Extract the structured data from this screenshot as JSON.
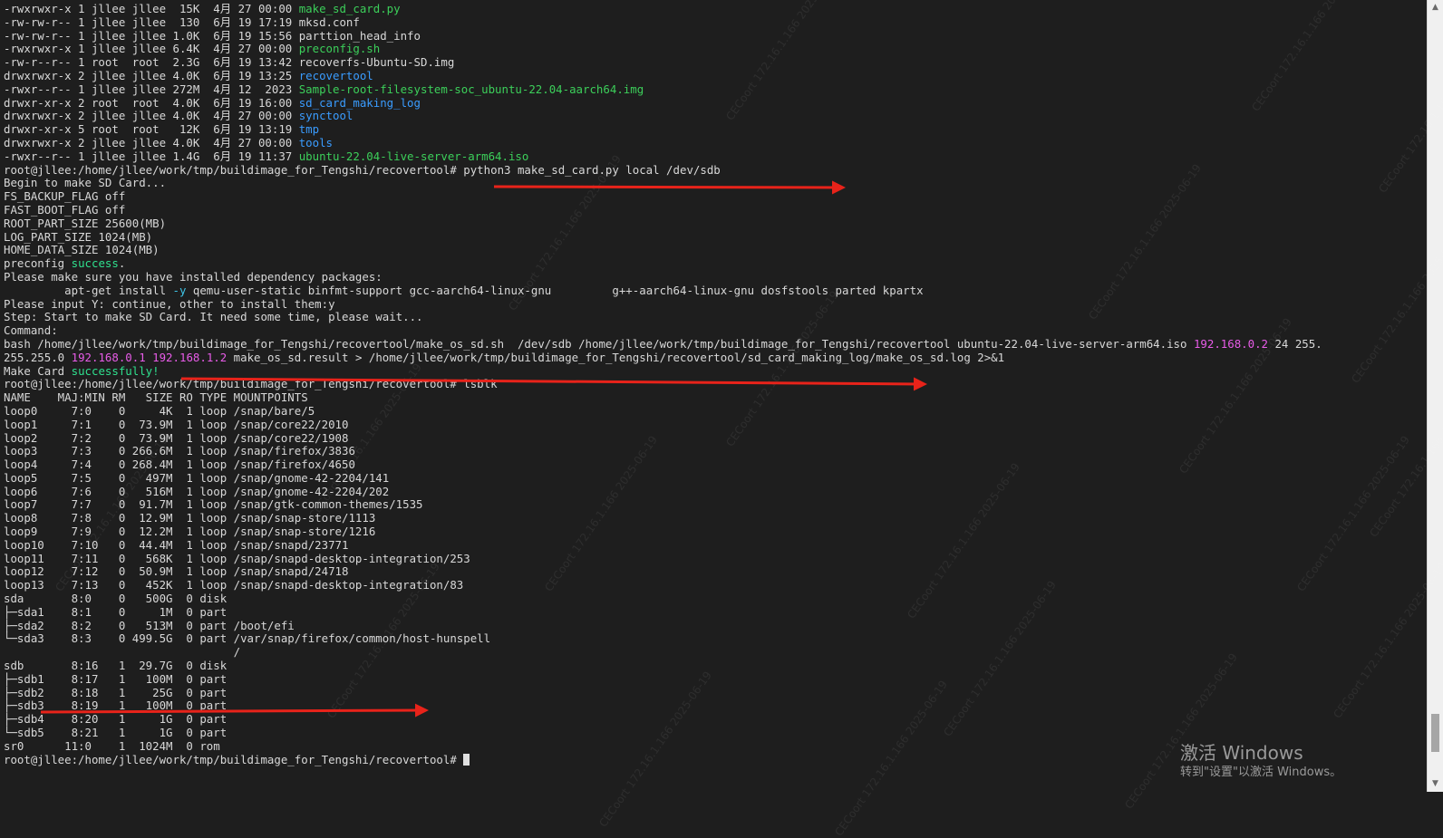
{
  "terminal": {
    "lines": [
      [
        {
          "t": "-rwxrwxr-x 1 jllee jllee  15K  4月 27 00:00 "
        },
        {
          "t": "make_sd_card.py",
          "c": "green"
        }
      ],
      [
        {
          "t": "-rw-rw-r-- 1 jllee jllee  130  6月 19 17:19 mksd.conf"
        }
      ],
      [
        {
          "t": "-rw-rw-r-- 1 jllee jllee 1.0K  6月 19 15:56 parttion_head_info"
        }
      ],
      [
        {
          "t": "-rwxrwxr-x 1 jllee jllee 6.4K  4月 27 00:00 "
        },
        {
          "t": "preconfig.sh",
          "c": "green"
        }
      ],
      [
        {
          "t": "-rw-r--r-- 1 root  root  2.3G  6月 19 13:42 recoverfs-Ubuntu-SD.img"
        }
      ],
      [
        {
          "t": "drwxrwxr-x 2 jllee jllee 4.0K  6月 19 13:25 "
        },
        {
          "t": "recovertool",
          "c": "blue"
        }
      ],
      [
        {
          "t": "-rwxr--r-- 1 jllee jllee 272M  4月 12  2023 "
        },
        {
          "t": "Sample-root-filesystem-soc_ubuntu-22.04-aarch64.img",
          "c": "green"
        }
      ],
      [
        {
          "t": "drwxr-xr-x 2 root  root  4.0K  6月 19 16:00 "
        },
        {
          "t": "sd_card_making_log",
          "c": "blue"
        }
      ],
      [
        {
          "t": "drwxrwxr-x 2 jllee jllee 4.0K  4月 27 00:00 "
        },
        {
          "t": "synctool",
          "c": "blue"
        }
      ],
      [
        {
          "t": "drwxr-xr-x 5 root  root   12K  6月 19 13:19 "
        },
        {
          "t": "tmp",
          "c": "blue"
        }
      ],
      [
        {
          "t": "drwxrwxr-x 2 jllee jllee 4.0K  4月 27 00:00 "
        },
        {
          "t": "tools",
          "c": "blue"
        }
      ],
      [
        {
          "t": "-rwxr--r-- 1 jllee jllee 1.4G  6月 19 11:37 "
        },
        {
          "t": "ubuntu-22.04-live-server-arm64.iso",
          "c": "green"
        }
      ],
      [
        {
          "t": "root@jllee:/home/jllee/work/tmp/buildimage_for_Tengshi/recovertool# python3 make_sd_card.py local /dev/sdb"
        }
      ],
      [
        {
          "t": "Begin to make SD Card..."
        }
      ],
      [
        {
          "t": "FS_BACKUP_FLAG off"
        }
      ],
      [
        {
          "t": "FAST_BOOT_FLAG off"
        }
      ],
      [
        {
          "t": "ROOT_PART_SIZE 25600(MB)"
        }
      ],
      [
        {
          "t": "LOG_PART_SIZE 1024(MB)"
        }
      ],
      [
        {
          "t": "HOME_DATA_SIZE 1024(MB)"
        }
      ],
      [
        {
          "t": "preconfig "
        },
        {
          "t": "success",
          "c": "bgreen"
        },
        {
          "t": "."
        }
      ],
      [
        {
          "t": "Please make sure you have installed dependency packages:"
        }
      ],
      [
        {
          "t": "         apt-get install "
        },
        {
          "t": "-y",
          "c": "cyan"
        },
        {
          "t": " qemu-user-static binfmt-support gcc-aarch64-linux-gnu         g++-aarch64-linux-gnu dosfstools parted kpartx"
        }
      ],
      [
        {
          "t": "Please input Y: continue, other to install them:y"
        }
      ],
      [
        {
          "t": "Step: Start to make SD Card. It need some time, please wait..."
        }
      ],
      [
        {
          "t": "Command:"
        }
      ],
      [
        {
          "t": "bash /home/jllee/work/tmp/buildimage_for_Tengshi/recovertool/make_os_sd.sh  /dev/sdb /home/jllee/work/tmp/buildimage_for_Tengshi/recovertool ubuntu-22.04-live-server-arm64.iso "
        },
        {
          "t": "192.168.0.2",
          "c": "magenta"
        },
        {
          "t": " 24 255."
        }
      ],
      [
        {
          "t": "255.255.0 "
        },
        {
          "t": "192.168.0.1",
          "c": "magenta"
        },
        {
          "t": " "
        },
        {
          "t": "192.168.1.2",
          "c": "magenta"
        },
        {
          "t": " make_os_sd.result > /home/jllee/work/tmp/buildimage_for_Tengshi/recovertool/sd_card_making_log/make_os_sd.log 2>&1"
        }
      ],
      [
        {
          "t": "Make Card "
        },
        {
          "t": "successfully!",
          "c": "bgreen"
        }
      ],
      [
        {
          "t": "root@jllee:/home/jllee/work/tmp/buildimage_for_Tengshi/recovertool# lsblk"
        }
      ],
      [
        {
          "t": "NAME    MAJ:MIN RM   SIZE RO TYPE MOUNTPOINTS"
        }
      ],
      [
        {
          "t": "loop0     7:0    0     4K  1 loop /snap/bare/5"
        }
      ],
      [
        {
          "t": "loop1     7:1    0  73.9M  1 loop /snap/core22/2010"
        }
      ],
      [
        {
          "t": "loop2     7:2    0  73.9M  1 loop /snap/core22/1908"
        }
      ],
      [
        {
          "t": "loop3     7:3    0 266.6M  1 loop /snap/firefox/3836"
        }
      ],
      [
        {
          "t": "loop4     7:4    0 268.4M  1 loop /snap/firefox/4650"
        }
      ],
      [
        {
          "t": "loop5     7:5    0   497M  1 loop /snap/gnome-42-2204/141"
        }
      ],
      [
        {
          "t": "loop6     7:6    0   516M  1 loop /snap/gnome-42-2204/202"
        }
      ],
      [
        {
          "t": "loop7     7:7    0  91.7M  1 loop /snap/gtk-common-themes/1535"
        }
      ],
      [
        {
          "t": "loop8     7:8    0  12.9M  1 loop /snap/snap-store/1113"
        }
      ],
      [
        {
          "t": "loop9     7:9    0  12.2M  1 loop /snap/snap-store/1216"
        }
      ],
      [
        {
          "t": "loop10    7:10   0  44.4M  1 loop /snap/snapd/23771"
        }
      ],
      [
        {
          "t": "loop11    7:11   0   568K  1 loop /snap/snapd-desktop-integration/253"
        }
      ],
      [
        {
          "t": "loop12    7:12   0  50.9M  1 loop /snap/snapd/24718"
        }
      ],
      [
        {
          "t": "loop13    7:13   0   452K  1 loop /snap/snapd-desktop-integration/83"
        }
      ],
      [
        {
          "t": "sda       8:0    0   500G  0 disk"
        }
      ],
      [
        {
          "t": "├─sda1    8:1    0     1M  0 part"
        }
      ],
      [
        {
          "t": "├─sda2    8:2    0   513M  0 part /boot/efi"
        }
      ],
      [
        {
          "t": "└─sda3    8:3    0 499.5G  0 part /var/snap/firefox/common/host-hunspell"
        }
      ],
      [
        {
          "t": "                                  /"
        }
      ],
      [
        {
          "t": "sdb       8:16   1  29.7G  0 disk"
        }
      ],
      [
        {
          "t": "├─sdb1    8:17   1   100M  0 part"
        }
      ],
      [
        {
          "t": "├─sdb2    8:18   1    25G  0 part"
        }
      ],
      [
        {
          "t": "├─sdb3    8:19   1   100M  0 part"
        }
      ],
      [
        {
          "t": "├─sdb4    8:20   1     1G  0 part"
        }
      ],
      [
        {
          "t": "└─sdb5    8:21   1     1G  0 part"
        }
      ],
      [
        {
          "t": "sr0      11:0    1  1024M  0 rom"
        }
      ],
      [
        {
          "t": "root@jllee:/home/jllee/work/tmp/buildimage_for_Tengshi/recovertool# "
        }
      ]
    ]
  },
  "colors": {
    "green": "#3ccf5a",
    "blue": "#3a9cff",
    "bgreen": "#2fe08e",
    "cyan": "#3ec4e6",
    "magenta": "#e85ce8",
    "arrow": "#e8231a"
  },
  "annotations": {
    "arrows": [
      "red-arrow-python-command",
      "red-arrow-make-card-success",
      "red-arrow-sdb2-partition"
    ]
  },
  "watermark": {
    "text": "CECoort 172.16.1.166 2025-06-19"
  },
  "windows_activation": {
    "title": "激活 Windows",
    "subtitle": "转到\"设置\"以激活 Windows。"
  }
}
